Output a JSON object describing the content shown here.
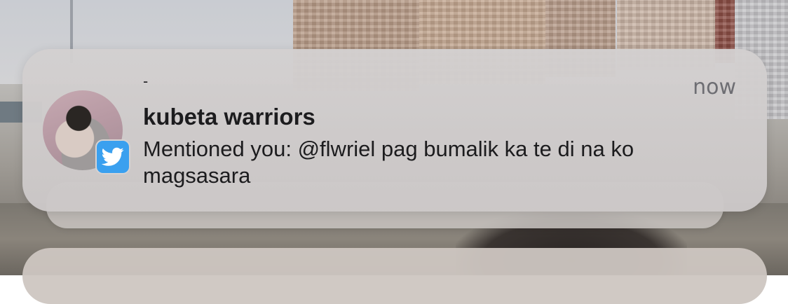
{
  "notification": {
    "app_mark": "-",
    "time": "now",
    "title": "kubeta warriors",
    "message": "Mentioned you: @flwriel pag bumalik ka te di na ko magsasara",
    "badge_icon": "twitter-bird-icon",
    "badge_color": "#3aa0ef"
  }
}
